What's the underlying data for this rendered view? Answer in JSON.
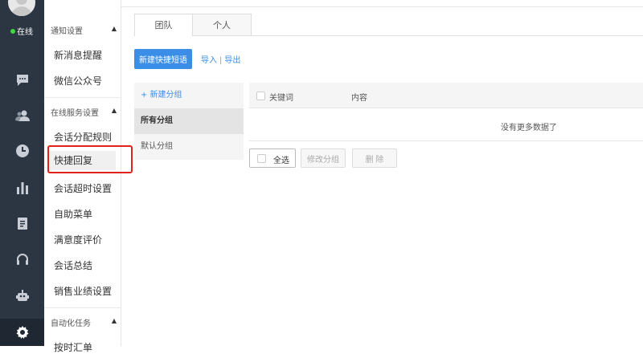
{
  "rail": {
    "status_label": "在线",
    "status_color": "#3fd83f",
    "icons": [
      "chat-icon",
      "contacts-icon",
      "clock-icon",
      "bar-chart-icon",
      "clipboard-icon",
      "headset-icon",
      "robot-icon",
      "gear-icon"
    ]
  },
  "sidebar": {
    "sections": [
      {
        "title": "通知设置",
        "items": [
          "新消息提醒",
          "微信公众号"
        ]
      },
      {
        "title": "在线服务设置",
        "items": [
          "会话分配规则",
          "快捷回复",
          "会话超时设置",
          "自助菜单",
          "满意度评价",
          "会话总结",
          "销售业绩设置"
        ]
      },
      {
        "title": "自动化任务",
        "items": [
          "按时汇单"
        ]
      }
    ],
    "active_item": "快捷回复"
  },
  "tabs": [
    "团队",
    "个人"
  ],
  "toolbar": {
    "new_button": "新建快捷短语",
    "import_link": "导入",
    "export_link": "导出",
    "separator": "|"
  },
  "groups": {
    "new_group": "+ 新建分组",
    "all": "所有分组",
    "default": "默认分组"
  },
  "table": {
    "columns": [
      "关键词",
      "内容"
    ],
    "empty_text": "没有更多数据了"
  },
  "bottom": {
    "select_all": "全选",
    "edit_group": "修改分组",
    "delete": "删 除"
  },
  "colors": {
    "accent": "#3a8ee6",
    "rail_bg": "#2c3542",
    "highlight": "#e0221b"
  }
}
